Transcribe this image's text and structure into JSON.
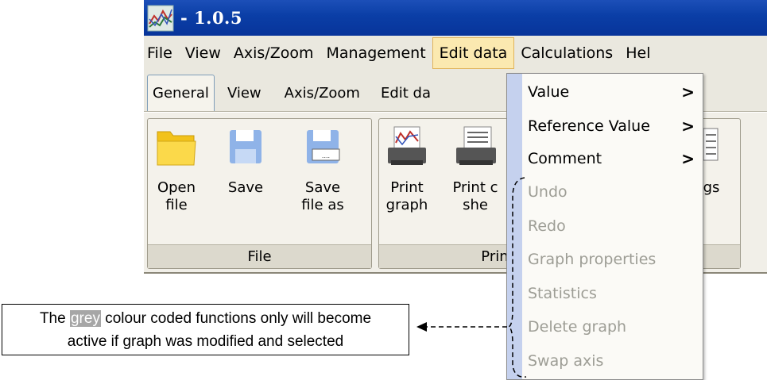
{
  "window": {
    "title": "- 1.0.5"
  },
  "menubar": [
    "File",
    "View",
    "Axis/Zoom",
    "Management",
    "Edit data",
    "Calculations",
    "Hel"
  ],
  "tabs": [
    "General",
    "View",
    "Axis/Zoom",
    "Edit da"
  ],
  "ribbon": {
    "file_group": {
      "label": "File",
      "buttons": [
        {
          "label": "Open\nfile",
          "icon": "folder-icon"
        },
        {
          "label": "Save",
          "icon": "save-icon"
        },
        {
          "label": "Save\nfile as",
          "icon": "save-as-icon"
        }
      ]
    },
    "print_group": {
      "label": "Print",
      "buttons": [
        {
          "label": "Print\ngraph",
          "icon": "print-graph-icon"
        },
        {
          "label": "Print c\nshe",
          "icon": "print-sheet-icon"
        }
      ]
    },
    "settings_partial": "gs"
  },
  "dropdown": {
    "items": [
      {
        "label": "Value",
        "submenu": true,
        "enabled": true
      },
      {
        "label": "Reference Value",
        "submenu": true,
        "enabled": true
      },
      {
        "label": "Comment",
        "submenu": true,
        "enabled": true
      },
      {
        "label": "Undo",
        "submenu": false,
        "enabled": false
      },
      {
        "label": "Redo",
        "submenu": false,
        "enabled": false
      },
      {
        "label": "Graph properties",
        "submenu": false,
        "enabled": false
      },
      {
        "label": "Statistics",
        "submenu": false,
        "enabled": false
      },
      {
        "label": "Delete graph",
        "submenu": false,
        "enabled": false
      },
      {
        "label": "Swap axis",
        "submenu": false,
        "enabled": false
      }
    ],
    "submenu_arrow": ">"
  },
  "annotation": {
    "before": "The ",
    "highlight": "grey",
    "after": " colour coded functions only will become",
    "line2": "active if graph was modified and selected"
  },
  "colors": {
    "titlebar": "#0a3ea6",
    "menu_highlight": "#fbe9b0",
    "disabled_text": "#9d9d95",
    "highlight_grey": "#a6a6a6"
  }
}
